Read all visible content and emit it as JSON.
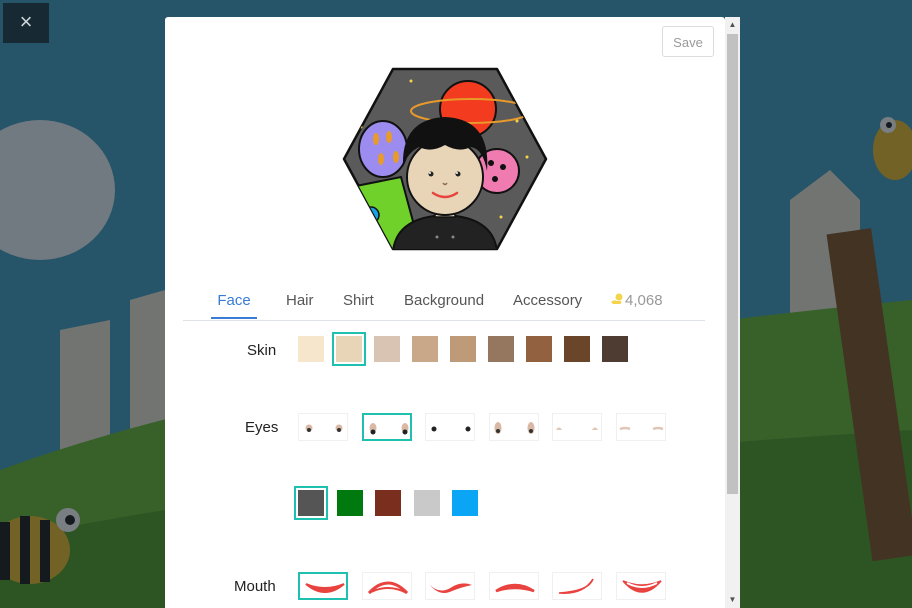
{
  "close_label": "×",
  "toolbar": {
    "save_label": "Save"
  },
  "tabs": [
    {
      "id": "face",
      "label": "Face",
      "active": true
    },
    {
      "id": "hair",
      "label": "Hair"
    },
    {
      "id": "shirt",
      "label": "Shirt"
    },
    {
      "id": "background",
      "label": "Background"
    },
    {
      "id": "accessory",
      "label": "Accessory"
    }
  ],
  "coins": {
    "value": "4,068",
    "icon": "hand-coin-icon"
  },
  "face": {
    "skin": {
      "label": "Skin",
      "colors": [
        "#f5e6cc",
        "#e8d5b8",
        "#d9c3b2",
        "#c9a88a",
        "#bf9a78",
        "#94775e",
        "#916140",
        "#6b4529",
        "#4e3b32"
      ],
      "selected_index": 1
    },
    "eyes": {
      "label": "Eyes",
      "styles": 6,
      "selected_index": 1,
      "colors": [
        "#555555",
        "#007a0e",
        "#7a2e1e",
        "#c9c9c9",
        "#0aa6f5"
      ],
      "selected_color_index": 0
    },
    "mouth": {
      "label": "Mouth",
      "styles": 6,
      "selected_index": 0,
      "color": "#e8433f"
    }
  },
  "colors": {
    "accent": "#3a7bd5",
    "selected_outline": "#20c0b0"
  }
}
